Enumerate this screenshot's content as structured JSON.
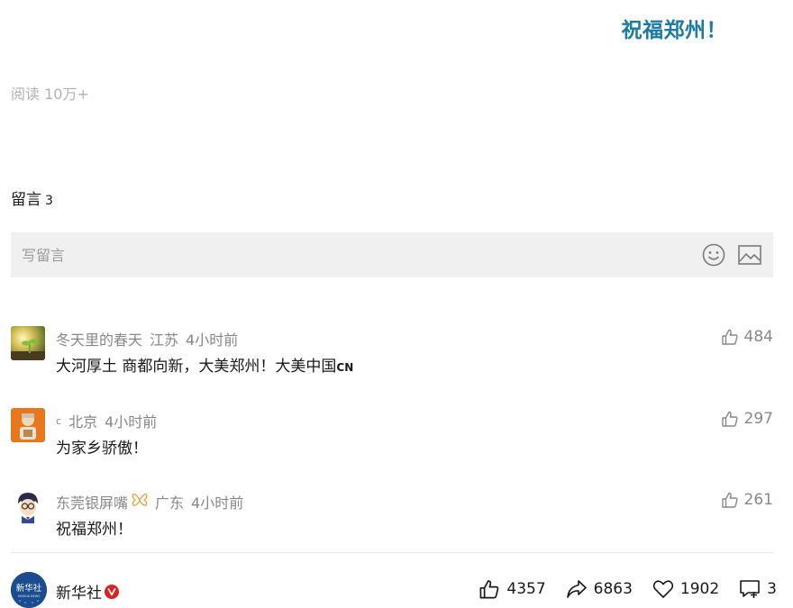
{
  "article": {
    "headline": "祝福郑州！",
    "read_count": "阅读 10万+"
  },
  "comments_section": {
    "title": "留言",
    "count": "3",
    "input_placeholder": "写留言",
    "emoji_icon": "emoji-icon",
    "image_icon": "image-icon"
  },
  "comments": [
    {
      "user": "冬天里的春天",
      "location": "江苏",
      "time": "4小时前",
      "text": "大河厚土 商都向新，大美郑州！大美中国",
      "text_suffix": "CN",
      "likes": "484",
      "avatar": "sunlight-sprout-avatar"
    },
    {
      "user": "ⅽ",
      "location": "北京",
      "time": "4小时前",
      "text": "为家乡骄傲！",
      "likes": "297",
      "avatar": "cartoon-avatar"
    },
    {
      "user": "东莞银屏嘴",
      "location": "广东",
      "time": "4小时前",
      "text": "祝福郑州！",
      "likes": "261",
      "avatar": "detective-conan-avatar"
    }
  ],
  "footer": {
    "account_name": "新华社",
    "logo_text": "新华社",
    "logo_sub": "XINHUA NEWS",
    "likes": "4357",
    "shares": "6863",
    "favorites": "1902",
    "comments": "3"
  },
  "colors": {
    "headline": "#1b7ba5",
    "muted": "#888888",
    "input_bg": "#f0f0f0",
    "verified": "#e02020",
    "logo_bg": "#1a4c8f"
  }
}
